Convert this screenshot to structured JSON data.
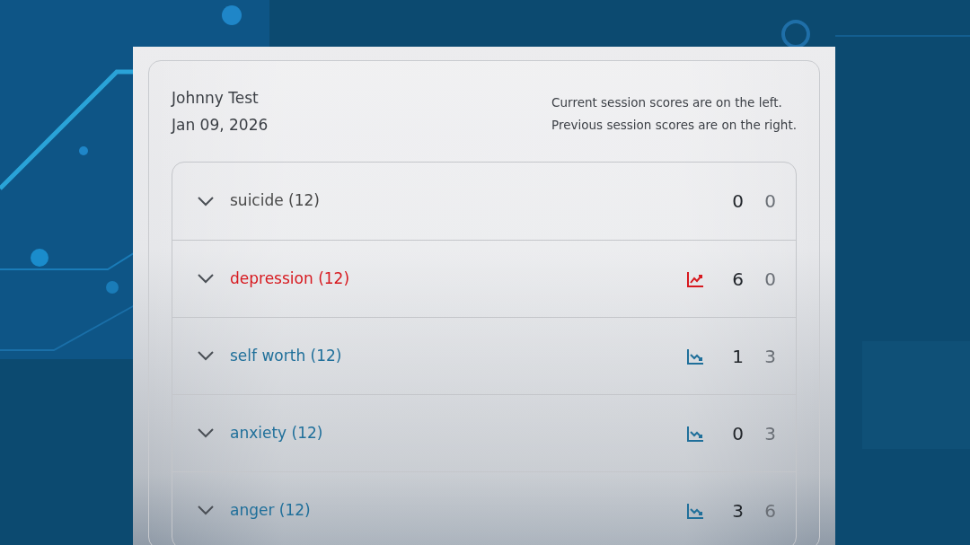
{
  "patient": {
    "name": "Johnny Test",
    "date": "Jan 09, 2026"
  },
  "legend": [
    "Current session scores are on the left.",
    "Previous session scores are on the right."
  ],
  "categories": [
    {
      "label": "suicide (12)",
      "color": "#4a4a4a",
      "kind": "plain",
      "current": "0",
      "previous": "0"
    },
    {
      "label": "depression (12)",
      "color": "#d7191f",
      "kind": "rising",
      "current": "6",
      "previous": "0"
    },
    {
      "label": "self worth (12)",
      "color": "#1f6f9a",
      "kind": "falling",
      "current": "1",
      "previous": "3"
    },
    {
      "label": "anxiety (12)",
      "color": "#1f6f9a",
      "kind": "falling",
      "current": "0",
      "previous": "3"
    },
    {
      "label": "anger (12)",
      "color": "#1f6f9a",
      "kind": "falling",
      "current": "3",
      "previous": "6"
    }
  ]
}
